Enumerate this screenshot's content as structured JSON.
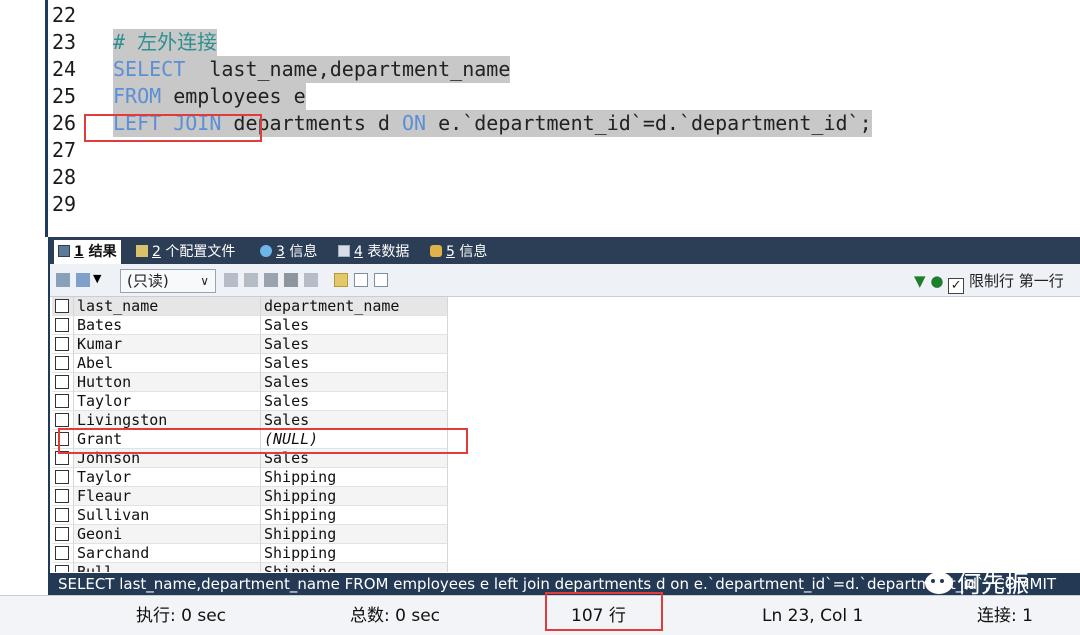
{
  "editor": {
    "lines": [
      {
        "num": "22",
        "code": ""
      },
      {
        "num": "23",
        "comment": "# 左外连接"
      },
      {
        "num": "24",
        "kw1": "SELECT",
        "rest1": "  last_name,department_name"
      },
      {
        "num": "25",
        "kw1": "FROM",
        "rest1": " employees e"
      },
      {
        "num": "26",
        "kw1": "LEFT JOIN",
        "rest1": " departments d ",
        "kw2": "ON",
        "rest2": " e.`department_id`=d.`department_id`;"
      },
      {
        "num": "27",
        "code": ""
      },
      {
        "num": "28",
        "code": ""
      },
      {
        "num": "29",
        "code": ""
      }
    ]
  },
  "tabs": [
    {
      "num": "1",
      "label": " 结果",
      "icon": "grid-icon"
    },
    {
      "num": "2",
      "label": " 个配置文件",
      "icon": "profile-icon"
    },
    {
      "num": "3",
      "label": " 信息",
      "icon": "info-icon"
    },
    {
      "num": "4",
      "label": " 表数据",
      "icon": "table-icon"
    },
    {
      "num": "5",
      "label": " 信息",
      "icon": "info2-icon"
    }
  ],
  "toolbar": {
    "readonly_label": "(只读)",
    "limit_label": "限制行 第一行"
  },
  "grid": {
    "headers": [
      "last_name",
      "department_name"
    ],
    "rows": [
      [
        "Bates",
        "Sales"
      ],
      [
        "Kumar",
        "Sales"
      ],
      [
        "Abel",
        "Sales"
      ],
      [
        "Hutton",
        "Sales"
      ],
      [
        "Taylor",
        "Sales"
      ],
      [
        "Livingston",
        "Sales"
      ],
      [
        "Grant",
        "(NULL)"
      ],
      [
        "Johnson",
        "Sales"
      ],
      [
        "Taylor",
        "Shipping"
      ],
      [
        "Fleaur",
        "Shipping"
      ],
      [
        "Sullivan",
        "Shipping"
      ],
      [
        "Geoni",
        "Shipping"
      ],
      [
        "Sarchand",
        "Shipping"
      ],
      [
        "Bull",
        "Shipping"
      ]
    ]
  },
  "sqlbar": {
    "text": "SELECT last_name,department_name FROM employees e left join departments d on e.`department_id`=d.`department_id`; COMMIT"
  },
  "watermark": {
    "text": "何先振"
  },
  "status": {
    "exec": "执行: 0 sec",
    "total": "总数: 0 sec",
    "rows": "107 行",
    "pos": "Ln 23, Col 1",
    "conn": "连接: 1"
  },
  "colors": {
    "keyword": "#5b8fd6",
    "highlight_box": "#e23b3b",
    "panel_dark": "#2b3e55"
  }
}
